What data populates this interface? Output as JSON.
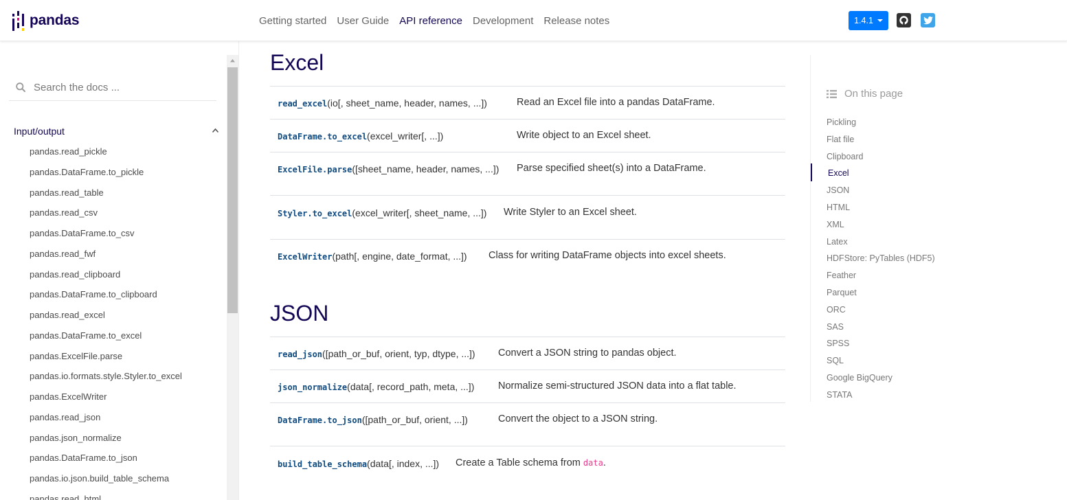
{
  "brand": {
    "name": "pandas"
  },
  "nav": {
    "links": [
      "Getting started",
      "User Guide",
      "API reference",
      "Development",
      "Release notes"
    ],
    "version": "1.4.1",
    "github_icon": "github-icon",
    "twitter_icon": "twitter-icon",
    "accent_color": "#130654",
    "version_color": "#007bff"
  },
  "sidebar": {
    "search_placeholder": "Search the docs ...",
    "section": "Input/output",
    "items": [
      "pandas.read_pickle",
      "pandas.DataFrame.to_pickle",
      "pandas.read_table",
      "pandas.read_csv",
      "pandas.DataFrame.to_csv",
      "pandas.read_fwf",
      "pandas.read_clipboard",
      "pandas.DataFrame.to_clipboard",
      "pandas.read_excel",
      "pandas.DataFrame.to_excel",
      "pandas.ExcelFile.parse",
      "pandas.io.formats.style.Styler.to_excel",
      "pandas.ExcelWriter",
      "pandas.read_json",
      "pandas.json_normalize",
      "pandas.DataFrame.to_json",
      "pandas.io.json.build_table_schema",
      "pandas.read_html"
    ]
  },
  "main": {
    "excel": {
      "title": "Excel",
      "rows": [
        {
          "fn": "read_excel",
          "args": "(io[, sheet_name, header, names, ...])",
          "desc": "Read an Excel file into a pandas DataFrame."
        },
        {
          "fn": "DataFrame.to_excel",
          "args": "(excel_writer[, ...])",
          "desc": "Write object to an Excel sheet."
        },
        {
          "fn": "ExcelFile.parse",
          "args": "([sheet_name, header, names, ...])",
          "desc": "Parse specified sheet(s) into a DataFrame."
        },
        {
          "fn": "Styler.to_excel",
          "args": "(excel_writer[, sheet_name, ...])",
          "desc": "Write Styler to an Excel sheet."
        },
        {
          "fn": "ExcelWriter",
          "args": "(path[, engine, date_format, ...])",
          "desc": "Class for writing DataFrame objects into excel sheets."
        }
      ]
    },
    "json": {
      "title": "JSON",
      "rows": [
        {
          "fn": "read_json",
          "args": "([path_or_buf, orient, typ, dtype, ...])",
          "desc": "Convert a JSON string to pandas object."
        },
        {
          "fn": "json_normalize",
          "args": "(data[, record_path, meta, ...])",
          "desc": "Normalize semi-structured JSON data into a flat table."
        },
        {
          "fn": "DataFrame.to_json",
          "args": "([path_or_buf, orient, ...])",
          "desc": "Convert the object to a JSON string."
        },
        {
          "fn": "build_table_schema",
          "args": "(data[, index, ...])",
          "desc": "Create a Table schema from ",
          "desc_code": "data",
          "desc_end": "."
        }
      ]
    }
  },
  "toc": {
    "title": "On this page",
    "items": [
      "Pickling",
      "Flat file",
      "Clipboard",
      "Excel",
      "JSON",
      "HTML",
      "XML",
      "Latex",
      "HDFStore: PyTables (HDF5)",
      "Feather",
      "Parquet",
      "ORC",
      "SAS",
      "SPSS",
      "SQL",
      "Google BigQuery",
      "STATA"
    ],
    "active": "Excel"
  }
}
